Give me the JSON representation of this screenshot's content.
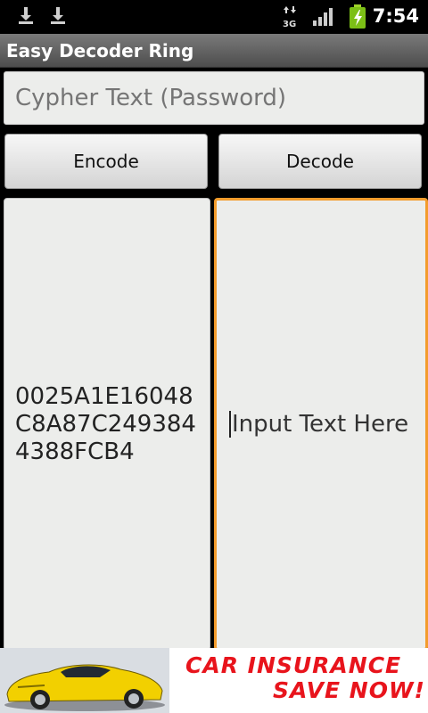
{
  "status_bar": {
    "time": "7:54",
    "network_type": "3G",
    "icons": [
      "download-icon",
      "download-icon",
      "data-activity-icon",
      "signal-icon",
      "battery-charging-icon"
    ]
  },
  "app": {
    "title": "Easy Decoder Ring"
  },
  "cipher": {
    "placeholder": "Cypher Text (Password)"
  },
  "buttons": {
    "encode": "Encode",
    "decode": "Decode"
  },
  "output": {
    "value": "0025A1E16048C8A87C2493844388FCB4"
  },
  "input": {
    "placeholder": "Input Text Here"
  },
  "ad": {
    "line1": "CAR INSURANCE",
    "line2": "SAVE NOW!"
  },
  "colors": {
    "focus_border": "#f39c2c",
    "ad_text": "#e8141c",
    "car": "#f2d000"
  }
}
